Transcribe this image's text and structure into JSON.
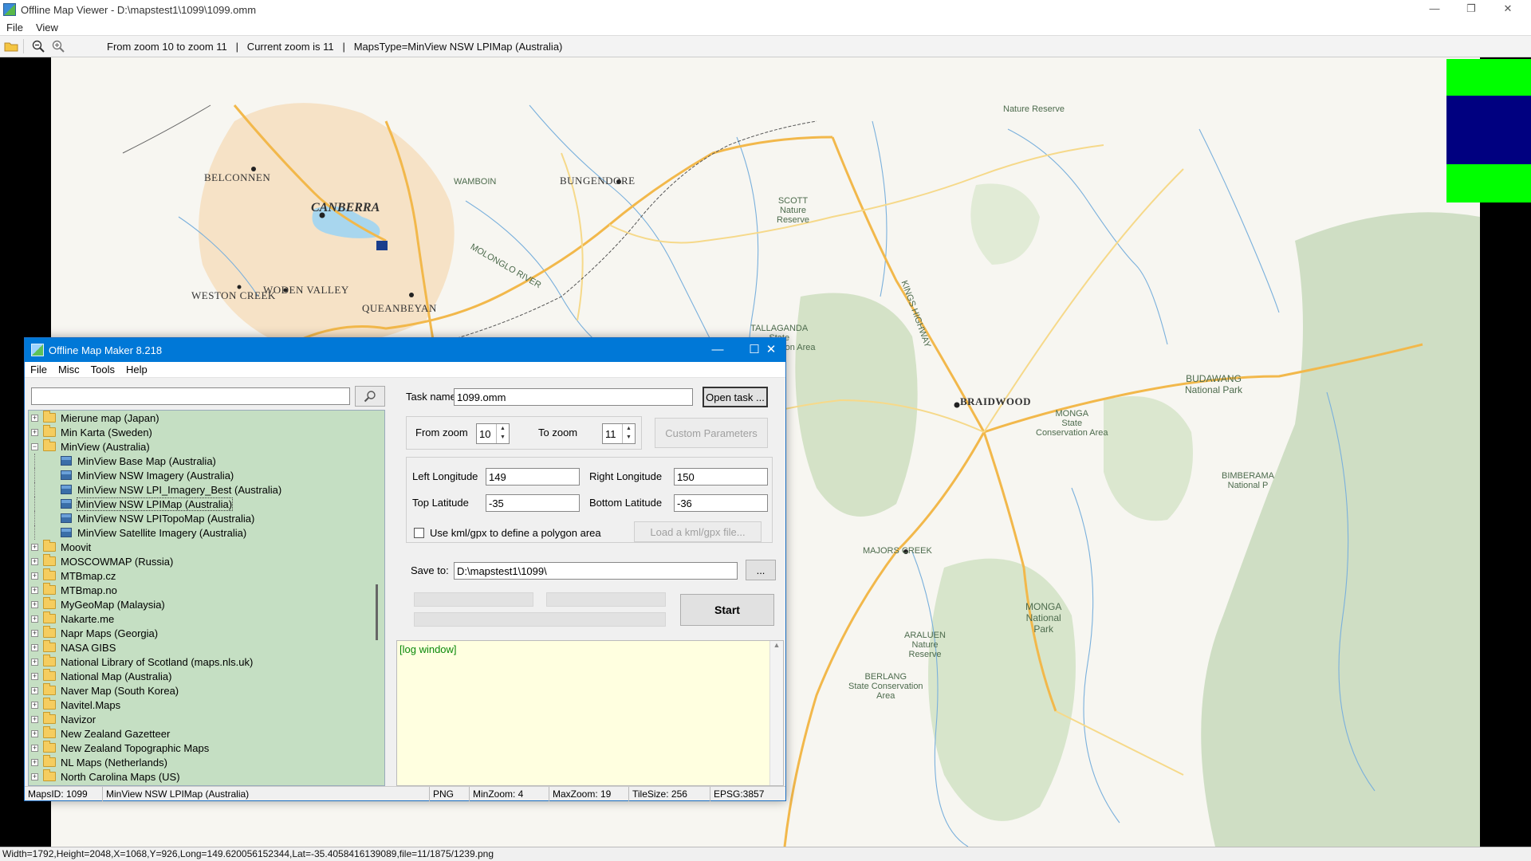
{
  "window": {
    "title": "Offline Map Viewer - D:\\mapstest1\\1099\\1099.omm",
    "minimize": "—",
    "maximize": "❐",
    "close": "✕"
  },
  "menu": {
    "file": "File",
    "view": "View"
  },
  "toolbar": {
    "info": "From zoom 10 to zoom 11   |   Current zoom is 11   |   MapsType=MinView NSW LPIMap (Australia)"
  },
  "map": {
    "labels": {
      "belconnen": "BELCONNEN",
      "canberra": "CANBERRA",
      "weston_creek": "WESTON CREEK",
      "woden_valley": "WODEN VALLEY",
      "queanbeyan": "QUEANBEYAN",
      "bungendore": "BUNGENDORE",
      "wamboin": "WAMBOIN",
      "braidwood": "BRAIDWOOD",
      "scott": "SCOTT\nNature\nReserve",
      "tallaganda": "TALLAGANDA\nState\nConservation Area",
      "monga_sca": "MONGA\nState\nConservation Area",
      "monga_np": "MONGA\nNational\nPark",
      "budawang": "BUDAWANG\nNational Park",
      "araluen": "ARALUEN\nNature\nReserve",
      "berlang": "BERLANG\nState Conservation\nArea",
      "nature_reserve": "Nature Reserve",
      "bimberamala": "BIMBERAMA\nNational P",
      "majors_creek": "MAJORS CREEK",
      "kings_highway": "KINGS HIGHWAY",
      "molonglo_river": "MOLONGLO RIVER"
    }
  },
  "statusbar": {
    "text": "Width=1792,Height=2048,X=1068,Y=926,Long=149.620056152344,Lat=-35.4058416139089,file=11/1875/1239.png"
  },
  "maker": {
    "title": "Offline Map Maker 8.218",
    "menu": {
      "file": "File",
      "misc": "Misc",
      "tools": "Tools",
      "help": "Help"
    },
    "search": {
      "value": "",
      "placeholder": ""
    },
    "tree": [
      {
        "label": "Mierune map (Japan)",
        "expanded": false
      },
      {
        "label": "Min Karta (Sweden)",
        "expanded": false
      },
      {
        "label": "MinView (Australia)",
        "expanded": true
      },
      {
        "label": "MinView Base Map (Australia)",
        "child": true
      },
      {
        "label": "MinView NSW Imagery (Australia)",
        "child": true
      },
      {
        "label": "MinView NSW LPI_Imagery_Best (Australia)",
        "child": true
      },
      {
        "label": "MinView NSW LPIMap (Australia)",
        "child": true,
        "selected": true
      },
      {
        "label": "MinView NSW LPITopoMap (Australia)",
        "child": true
      },
      {
        "label": "MinView Satellite Imagery (Australia)",
        "child": true
      },
      {
        "label": "Moovit",
        "expanded": false
      },
      {
        "label": "MOSCOWMAP (Russia)",
        "expanded": false
      },
      {
        "label": "MTBmap.cz",
        "expanded": false
      },
      {
        "label": "MTBmap.no",
        "expanded": false
      },
      {
        "label": "MyGeoMap (Malaysia)",
        "expanded": false
      },
      {
        "label": "Nakarte.me",
        "expanded": false
      },
      {
        "label": "Napr Maps (Georgia)",
        "expanded": false
      },
      {
        "label": "NASA GIBS",
        "expanded": false
      },
      {
        "label": "National Library of Scotland (maps.nls.uk)",
        "expanded": false
      },
      {
        "label": "National Map (Australia)",
        "expanded": false
      },
      {
        "label": "Naver Map (South Korea)",
        "expanded": false
      },
      {
        "label": "Navitel.Maps",
        "expanded": false
      },
      {
        "label": "Navizor",
        "expanded": false
      },
      {
        "label": "New Zealand Gazetteer",
        "expanded": false
      },
      {
        "label": "New Zealand Topographic Maps",
        "expanded": false
      },
      {
        "label": "NL Maps (Netherlands)",
        "expanded": false
      },
      {
        "label": "North Carolina Maps (US)",
        "expanded": false
      }
    ],
    "task": {
      "label": "Task name",
      "value": "1099.omm",
      "open_button": "Open task ..."
    },
    "zoom": {
      "from_label": "From zoom",
      "from_value": "10",
      "to_label": "To zoom",
      "to_value": "11",
      "custom_button": "Custom Parameters"
    },
    "coords": {
      "left_lon_label": "Left Longitude",
      "left_lon": "149",
      "right_lon_label": "Right Longitude",
      "right_lon": "150",
      "top_lat_label": "Top Latitude",
      "top_lat": "-35",
      "bottom_lat_label": "Bottom Latitude",
      "bottom_lat": "-36"
    },
    "kml": {
      "label": "Use kml/gpx to define a polygon area",
      "button": "Load a kml/gpx file...",
      "checked": false
    },
    "save": {
      "label": "Save to:",
      "value": "D:\\mapstest1\\1099\\",
      "browse": "..."
    },
    "start_button": "Start",
    "log": "[log window]",
    "status": {
      "maps_id": "MapsID: 1099",
      "maps_name": "MinView NSW LPIMap (Australia)",
      "format": "PNG",
      "min_zoom": "MinZoom: 4",
      "max_zoom": "MaxZoom: 19",
      "tile_size": "TileSize: 256",
      "epsg": "EPSG:3857"
    }
  },
  "colors": {
    "dialog_title": "#0078d7",
    "tree_bg": "#c5dfc3",
    "log_bg": "#ffffe0",
    "overview_green": "#00ff00",
    "overview_blue": "#000080"
  }
}
